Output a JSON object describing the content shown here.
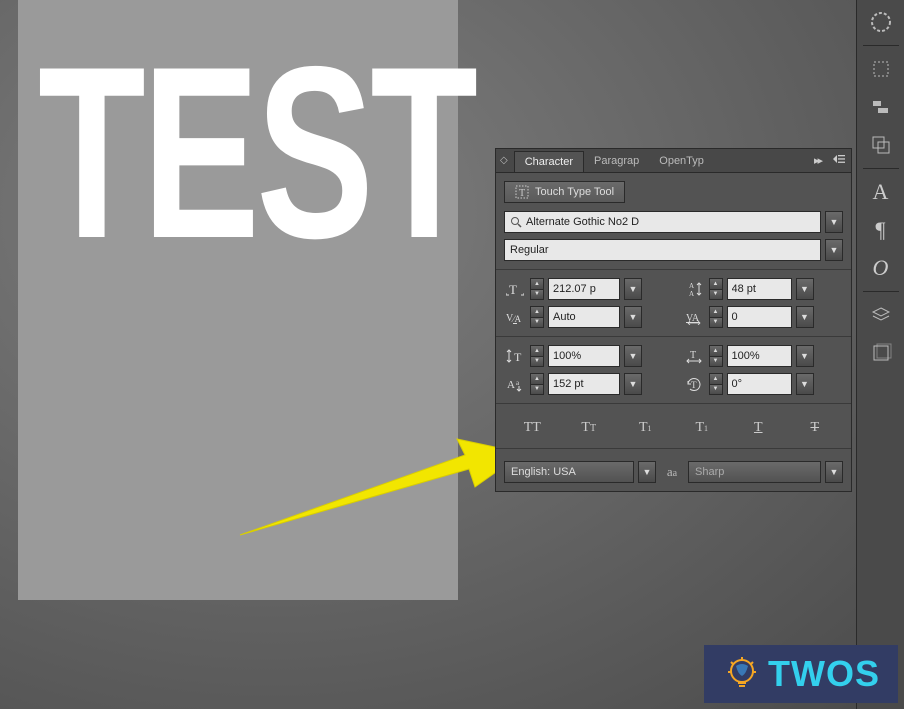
{
  "canvas": {
    "text": "TEST"
  },
  "panel": {
    "tabs": {
      "character": "Character",
      "paragraph": "Paragrap",
      "opentype": "OpenTyp"
    },
    "touch_type_label": "Touch Type Tool",
    "font_family": "Alternate Gothic No2 D",
    "font_style": "Regular",
    "font_size": "212.07 p",
    "leading": "48 pt",
    "kerning": "Auto",
    "tracking": "0",
    "vertical_scale": "100%",
    "horizontal_scale": "100%",
    "baseline_shift": "152 pt",
    "rotation": "0°",
    "language": "English: USA",
    "anti_alias": "Sharp"
  },
  "watermark": {
    "text": "TWOS"
  }
}
